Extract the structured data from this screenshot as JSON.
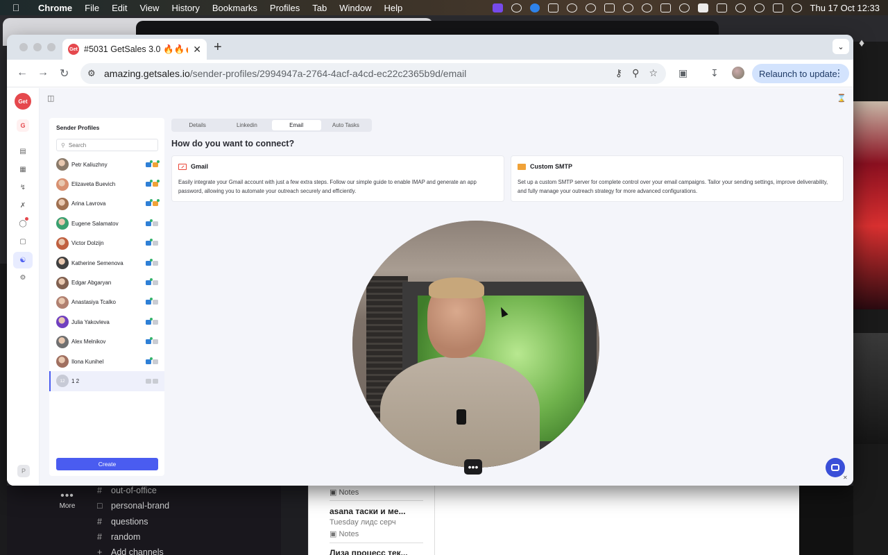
{
  "menubar": {
    "app": "Chrome",
    "items": [
      "File",
      "Edit",
      "View",
      "History",
      "Bookmarks",
      "Profiles",
      "Tab",
      "Window",
      "Help"
    ],
    "clock": "Thu 17 Oct  12:33"
  },
  "browser": {
    "tab_title": "#5031 GetSales 3.0 🔥🔥🔥",
    "favicon_text": "Get",
    "url_host": "amazing.getsales.io",
    "url_path": "/sender-profiles/2994947a-2764-4acf-a4cd-ec22c2365b9d/email",
    "relaunch_label": "Relaunch to update"
  },
  "rail": {
    "logo": "Get",
    "workspace": "G",
    "bottom": "P"
  },
  "sender_panel": {
    "title": "Sender Profiles",
    "search_placeholder": "Search",
    "create_label": "Create",
    "profiles": [
      {
        "name": "Petr Kaliuzhny",
        "email_connected": true
      },
      {
        "name": "Elizaveta Buevich",
        "email_connected": true
      },
      {
        "name": "Arina Lavrova",
        "email_connected": true
      },
      {
        "name": "Eugene Salamatov",
        "email_connected": false
      },
      {
        "name": "Victor Dolzijn",
        "email_connected": false
      },
      {
        "name": "Katherine Semenova",
        "email_connected": false
      },
      {
        "name": "Edgar Abgaryan",
        "email_connected": false
      },
      {
        "name": "Anastasiya Tcalko",
        "email_connected": false
      },
      {
        "name": "Julia Yakovleva",
        "email_connected": false
      },
      {
        "name": "Alex Melnikov",
        "email_connected": false
      },
      {
        "name": "Ilona Kunihel",
        "email_connected": false
      },
      {
        "name": "1 2",
        "avatar_text": "12",
        "email_connected": false
      }
    ]
  },
  "detail": {
    "tabs": [
      "Details",
      "Linkedin",
      "Email",
      "Auto Tasks"
    ],
    "active_tab": "Email",
    "heading": "How do you want to connect?",
    "options": [
      {
        "title": "Gmail",
        "icon": "gmail-icon",
        "description": "Easily integrate your Gmail account with just a few extra steps. Follow our simple guide to enable IMAP and generate an app password, allowing you to automate your outreach securely and efficiently."
      },
      {
        "title": "Custom SMTP",
        "icon": "envelope-icon",
        "description": "Set up a custom SMTP server for complete control over your email campaigns. Tailor your sending settings, improve deliverability, and fully manage your outreach strategy for more advanced configurations."
      }
    ]
  },
  "slack": {
    "more_label": "More",
    "channels": [
      "out-of-office",
      "personal-brand",
      "questions",
      "random"
    ],
    "add_channels": "Add channels"
  },
  "notes_panel": {
    "folder_label": "Notes",
    "item_title": "asana таски и ме...",
    "item_meta": "Tuesday  лидс серч",
    "item_folder": "Notes",
    "next_title": "Лиза процесс тек..."
  }
}
